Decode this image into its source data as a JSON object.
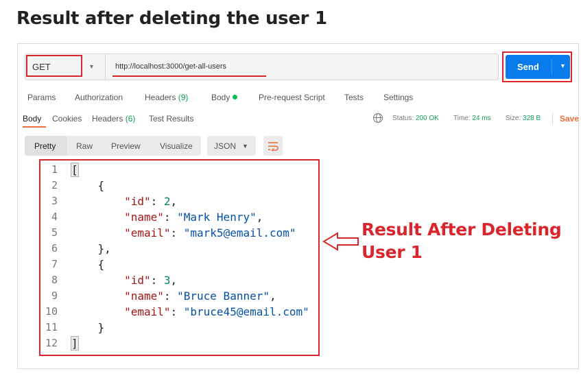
{
  "heading": "Result after deleting the user 1",
  "request": {
    "method": "GET",
    "url": "http://localhost:3000/get-all-users",
    "send_label": "Send"
  },
  "request_tabs": {
    "params": "Params",
    "authorization": "Authorization",
    "headers": "Headers",
    "headers_count": "(9)",
    "body": "Body",
    "prerequest": "Pre-request Script",
    "tests": "Tests",
    "settings": "Settings"
  },
  "response_tabs": {
    "body": "Body",
    "cookies": "Cookies",
    "headers": "Headers",
    "headers_count": "(6)",
    "test_results": "Test Results"
  },
  "status": {
    "status_label": "Status:",
    "status_value": "200 OK",
    "time_label": "Time:",
    "time_value": "24 ms",
    "size_label": "Size:",
    "size_value": "328 B",
    "save_label": "Save"
  },
  "view": {
    "pretty": "Pretty",
    "raw": "Raw",
    "preview": "Preview",
    "visualize": "Visualize",
    "format": "JSON"
  },
  "code": {
    "line_numbers": [
      "1",
      "2",
      "3",
      "4",
      "5",
      "6",
      "7",
      "8",
      "9",
      "10",
      "11",
      "12"
    ],
    "users": [
      {
        "id": "2",
        "name": "\"Mark Henry\"",
        "email": "\"mark5@email.com\""
      },
      {
        "id": "3",
        "name": "\"Bruce Banner\"",
        "email": "\"bruce45@email.com\""
      }
    ],
    "keys": {
      "id": "\"id\"",
      "name": "\"name\"",
      "email": "\"email\""
    }
  },
  "callout": {
    "line1": "Result After Deleting",
    "line2": "User 1"
  },
  "colors": {
    "highlight": "#d9262c",
    "send_button": "#097bed",
    "status_green": "#0f9d58",
    "accent_orange": "#f26b3a"
  }
}
